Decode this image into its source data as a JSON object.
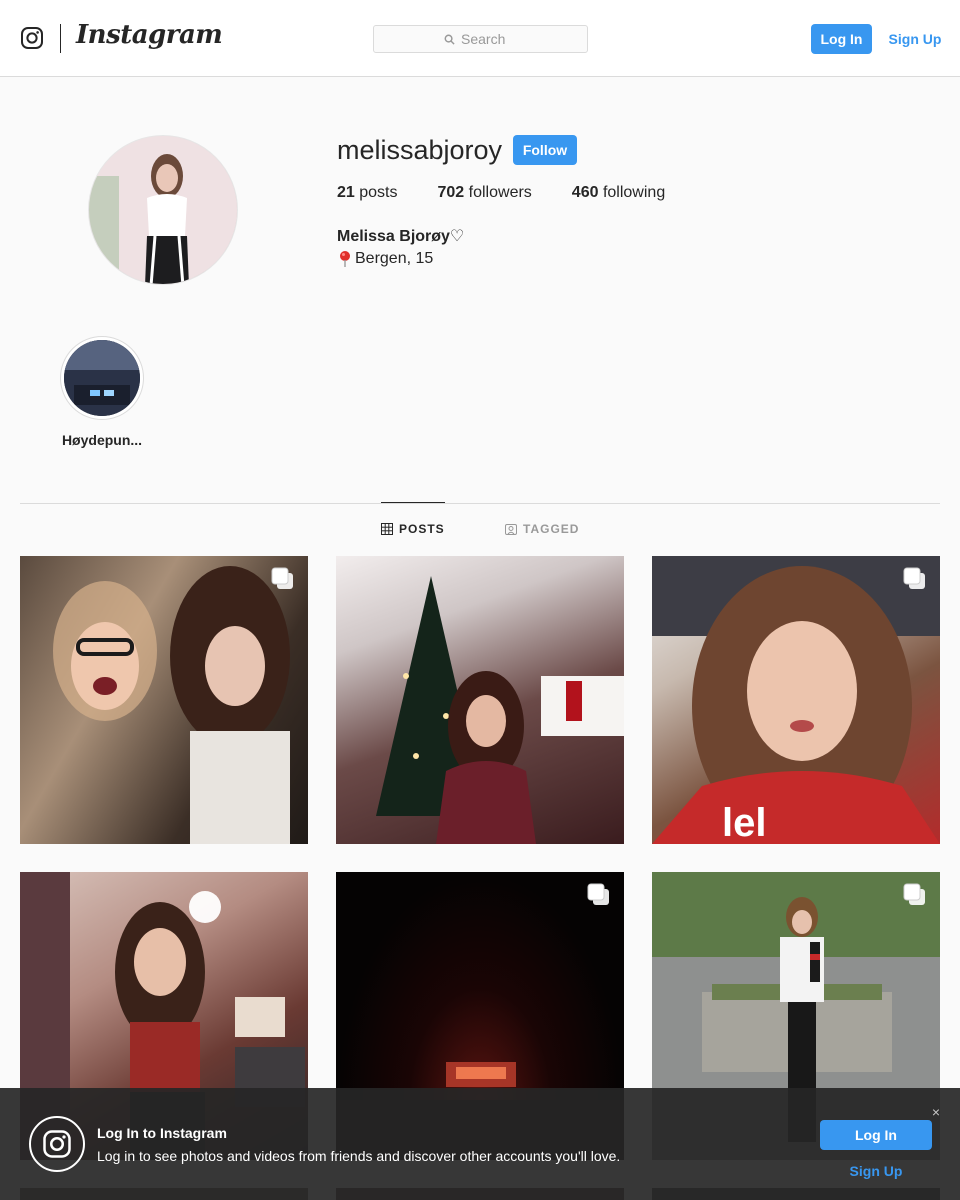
{
  "header": {
    "logo_icon": "instagram-glyph-icon",
    "wordmark": "Instagram",
    "search_placeholder": "Search",
    "login_label": "Log In",
    "signup_label": "Sign Up",
    "accent_color": "#3897f0"
  },
  "profile": {
    "username": "melissabjoroy",
    "follow_label": "Follow",
    "posts_count": "21",
    "posts_label": "posts",
    "followers_count": "702",
    "followers_label": "followers",
    "following_count": "460",
    "following_label": "following",
    "full_name": "Melissa Bjorøy♡",
    "bio": "Bergen, 15",
    "bio_icon": "round-pushpin-icon"
  },
  "highlights": [
    {
      "label": "Høydepun..."
    }
  ],
  "tabs": [
    {
      "label": "POSTS",
      "icon": "grid-icon",
      "active": true
    },
    {
      "label": "TAGGED",
      "icon": "tag-portrait-icon",
      "active": false
    }
  ],
  "posts": [
    {
      "multi": true
    },
    {
      "multi": false
    },
    {
      "multi": true
    },
    {
      "multi": false
    },
    {
      "multi": true
    },
    {
      "multi": true
    }
  ],
  "banner": {
    "title": "Log In to Instagram",
    "text": "Log in to see photos and videos from friends and discover other accounts you'll love.",
    "login_label": "Log In",
    "signup_label": "Sign Up",
    "close_label": "×"
  }
}
